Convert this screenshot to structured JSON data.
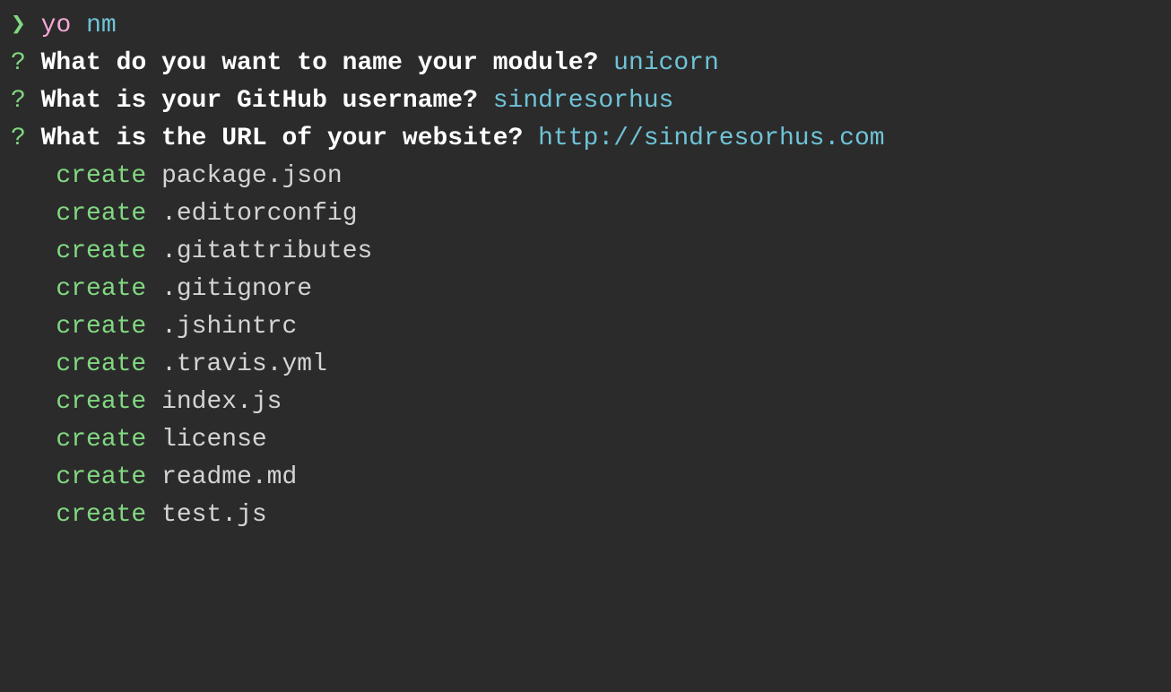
{
  "prompt": {
    "caret": "❯",
    "cmd_yo": "yo",
    "cmd_nm": "nm"
  },
  "questions": [
    {
      "mark": "?",
      "text": "What do you want to name your module?",
      "answer": "unicorn"
    },
    {
      "mark": "?",
      "text": "What is your GitHub username?",
      "answer": "sindresorhus"
    },
    {
      "mark": "?",
      "text": "What is the URL of your website?",
      "answer": "http://sindresorhus.com"
    }
  ],
  "creates": [
    {
      "action": "create",
      "file": "package.json"
    },
    {
      "action": "create",
      "file": ".editorconfig"
    },
    {
      "action": "create",
      "file": ".gitattributes"
    },
    {
      "action": "create",
      "file": ".gitignore"
    },
    {
      "action": "create",
      "file": ".jshintrc"
    },
    {
      "action": "create",
      "file": ".travis.yml"
    },
    {
      "action": "create",
      "file": "index.js"
    },
    {
      "action": "create",
      "file": "license"
    },
    {
      "action": "create",
      "file": "readme.md"
    },
    {
      "action": "create",
      "file": "test.js"
    }
  ]
}
